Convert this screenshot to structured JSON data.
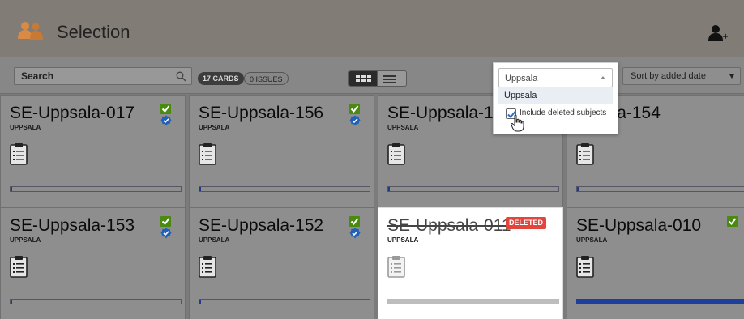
{
  "header": {
    "title": "Selection",
    "logo_icon": "people-icon",
    "add_user_icon": "add-user-icon",
    "logo_color": "#d98a45"
  },
  "toolbar": {
    "search_label": "Search",
    "search_icon": "magnifier-icon",
    "cards_badge": "17 CARDS",
    "issues_badge": "0 ISSUES",
    "grid_view_icon": "grid-view-icon",
    "list_view_icon": "list-view-icon",
    "sort_label": "Sort by added date",
    "sort_icon": "chevron-down-icon"
  },
  "filter_popup": {
    "selected": "Uppsala",
    "options": [
      "Uppsala"
    ],
    "include_deleted_label": "Include deleted subjects",
    "include_deleted_checked": true,
    "cursor_icon": "hand-pointer-icon"
  },
  "cards": [
    {
      "name": "SE-Uppsala-017",
      "site": "UPPSALA",
      "checked": true,
      "verified": true,
      "progress": 0.0,
      "deleted": false
    },
    {
      "name": "SE-Uppsala-156",
      "site": "UPPSALA",
      "checked": true,
      "verified": true,
      "progress": 0.0,
      "deleted": false
    },
    {
      "name": "SE-Uppsala-1",
      "site": "UPPSALA",
      "checked": true,
      "verified": true,
      "progress": 0.0,
      "deleted": false
    },
    {
      "name": "ppsala-154",
      "site": "UPPSALA",
      "checked": false,
      "verified": false,
      "progress": 0.0,
      "deleted": false
    },
    {
      "name": "SE-Uppsala-153",
      "site": "UPPSALA",
      "checked": true,
      "verified": true,
      "progress": 0.0,
      "deleted": false
    },
    {
      "name": "SE-Uppsala-152",
      "site": "UPPSALA",
      "checked": true,
      "verified": true,
      "progress": 0.0,
      "deleted": false
    },
    {
      "name": "SE-Uppsala-011",
      "site": "UPPSALA",
      "checked": false,
      "verified": false,
      "progress": 0.0,
      "deleted": true,
      "deleted_label": "DELETED"
    },
    {
      "name": "SE-Uppsala-010",
      "site": "UPPSALA",
      "checked": true,
      "verified": false,
      "progress": 1.0,
      "deleted": false
    }
  ],
  "colors": {
    "check_green": "#4b8a10",
    "shield_blue": "#1f61b8",
    "deleted_red": "#e2453c",
    "progress_blue": "#1e3f9b"
  }
}
